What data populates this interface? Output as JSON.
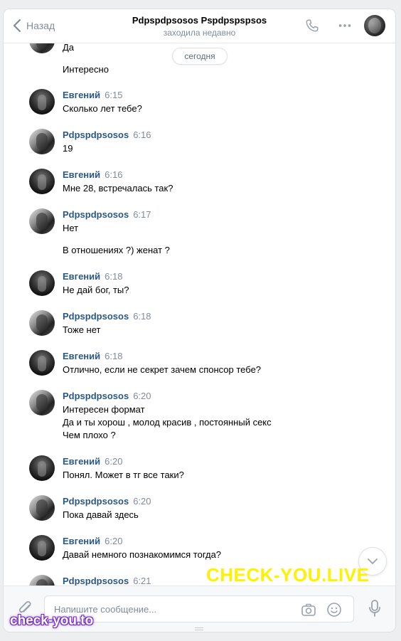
{
  "header": {
    "back_label": "Назад",
    "title": "Pdpspdpsosos Pspdpspspsos",
    "subtitle": "заходила недавно",
    "icons": [
      "chevron-left-icon",
      "phone-icon",
      "more-icon"
    ]
  },
  "date_separator": "сегодня",
  "partial_message": {
    "text_1": "Да",
    "text_2": "Интересно"
  },
  "messages": [
    {
      "author": "Евгений",
      "time": "6:15",
      "lines": [
        "Сколько лет тебе?"
      ]
    },
    {
      "author": "Pdpspdpsosos",
      "time": "6:16",
      "lines": [
        "19"
      ]
    },
    {
      "author": "Евгений",
      "time": "6:16",
      "lines": [
        "Мне 28, встречалась так?"
      ]
    },
    {
      "author": "Pdpspdpsosos",
      "time": "6:17",
      "lines": [
        "Нет",
        "В отношениях ?) женат ?"
      ]
    },
    {
      "author": "Евгений",
      "time": "6:18",
      "lines": [
        "Не дай бог, ты?"
      ]
    },
    {
      "author": "Pdpspdpsosos",
      "time": "6:18",
      "lines": [
        "Тоже нет"
      ]
    },
    {
      "author": "Евгений",
      "time": "6:18",
      "lines": [
        "Отлично, если не секрет зачем спонсор тебе?"
      ]
    },
    {
      "author": "Pdpspdpsosos",
      "time": "6:20",
      "lines": [
        "Интересен формат",
        "Да и ты хорош , молод красив , постоянный секс",
        "Чем плохо ?"
      ]
    },
    {
      "author": "Евгений",
      "time": "6:20",
      "lines": [
        "Понял. Может в тг все таки?"
      ]
    },
    {
      "author": "Pdpspdpsosos",
      "time": "6:20",
      "lines": [
        "Пока давай здесь"
      ]
    },
    {
      "author": "Евгений",
      "time": "6:20",
      "lines": [
        "Давай немного познакомимся тогда?"
      ]
    },
    {
      "author": "Pdpspdpsosos",
      "time": "6:21",
      "lines": []
    }
  ],
  "composer": {
    "placeholder": "Напишите сообщение..."
  },
  "watermarks": {
    "big": "CHECK-YOU.LIVE",
    "small": "check-you.to"
  },
  "colors": {
    "name": "#2a5885",
    "muted": "#818c99",
    "watermark_big": "#fff200",
    "watermark_small_outline": "#7b2cbf"
  }
}
